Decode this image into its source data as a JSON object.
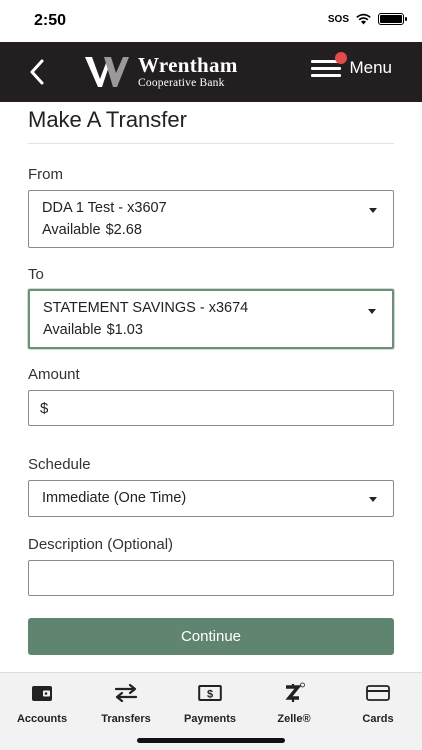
{
  "status": {
    "time": "2:50",
    "carrier": "SOS"
  },
  "header": {
    "bank_name": "Wrentham",
    "bank_sub": "Cooperative Bank",
    "menu_label": "Menu"
  },
  "page": {
    "title": "Make A Transfer"
  },
  "from": {
    "label": "From",
    "account": "DDA 1 Test - x3607",
    "available_label": "Available",
    "available_amount": "$2.68"
  },
  "to": {
    "label": "To",
    "account": "STATEMENT SAVINGS - x3674",
    "available_label": "Available",
    "available_amount": "$1.03"
  },
  "amount": {
    "label": "Amount",
    "currency_symbol": "$",
    "value": ""
  },
  "schedule": {
    "label": "Schedule",
    "selected": "Immediate (One Time)"
  },
  "description": {
    "label": "Description (Optional)",
    "value": ""
  },
  "continue_label": "Continue",
  "tabs": [
    {
      "label": "Accounts",
      "icon": "wallet-icon"
    },
    {
      "label": "Transfers",
      "icon": "transfer-arrows-icon"
    },
    {
      "label": "Payments",
      "icon": "dollar-bill-icon"
    },
    {
      "label": "Zelle®",
      "icon": "zelle-icon"
    },
    {
      "label": "Cards",
      "icon": "credit-card-icon"
    }
  ],
  "colors": {
    "header_bg": "#231f20",
    "accent": "#5f8570",
    "notification": "#e34a4a"
  }
}
